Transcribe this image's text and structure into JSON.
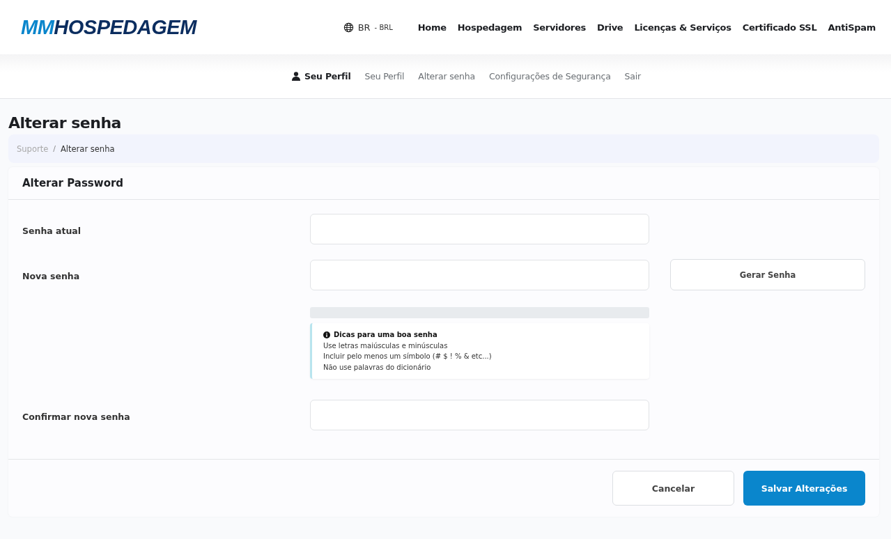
{
  "header": {
    "logo": {
      "accent": "MM",
      "rest": "HOSPEDAGEM"
    },
    "locale": {
      "code": "BR",
      "currency": "- BRL"
    },
    "nav": [
      "Home",
      "Hospedagem",
      "Servidores",
      "Drive",
      "Licenças & Serviços",
      "Certificado SSL",
      "AntiSpam"
    ]
  },
  "subnav": [
    {
      "label": "Seu Perfil",
      "selected": true
    },
    {
      "label": "Seu Perfil",
      "selected": false
    },
    {
      "label": "Alterar senha",
      "selected": false
    },
    {
      "label": "Configurações de Segurança",
      "selected": false
    },
    {
      "label": "Sair",
      "selected": false
    }
  ],
  "page_title": "Alterar senha",
  "breadcrumb_separator": "/",
  "breadcrumb": [
    {
      "label": "Suporte",
      "selected": false
    },
    {
      "label": "Alterar senha",
      "selected": true
    }
  ],
  "card": {
    "title": "Alterar Password",
    "current_label": "Senha atual",
    "new_label": "Nova senha",
    "generate_button": "Gerar Senha",
    "strength": {
      "level": 0
    },
    "tips": {
      "title": "Dicas para uma boa senha",
      "lines": [
        "Use letras maiúsculas e minúsculas",
        "Incluir pelo menos um símbolo (# $ ! % & etc...)",
        "Não use palavras do dicionário"
      ]
    },
    "confirm_label": "Confirmar nova senha",
    "buttons": {
      "cancel": "Cancelar",
      "save": "Salvar Alterações"
    }
  }
}
